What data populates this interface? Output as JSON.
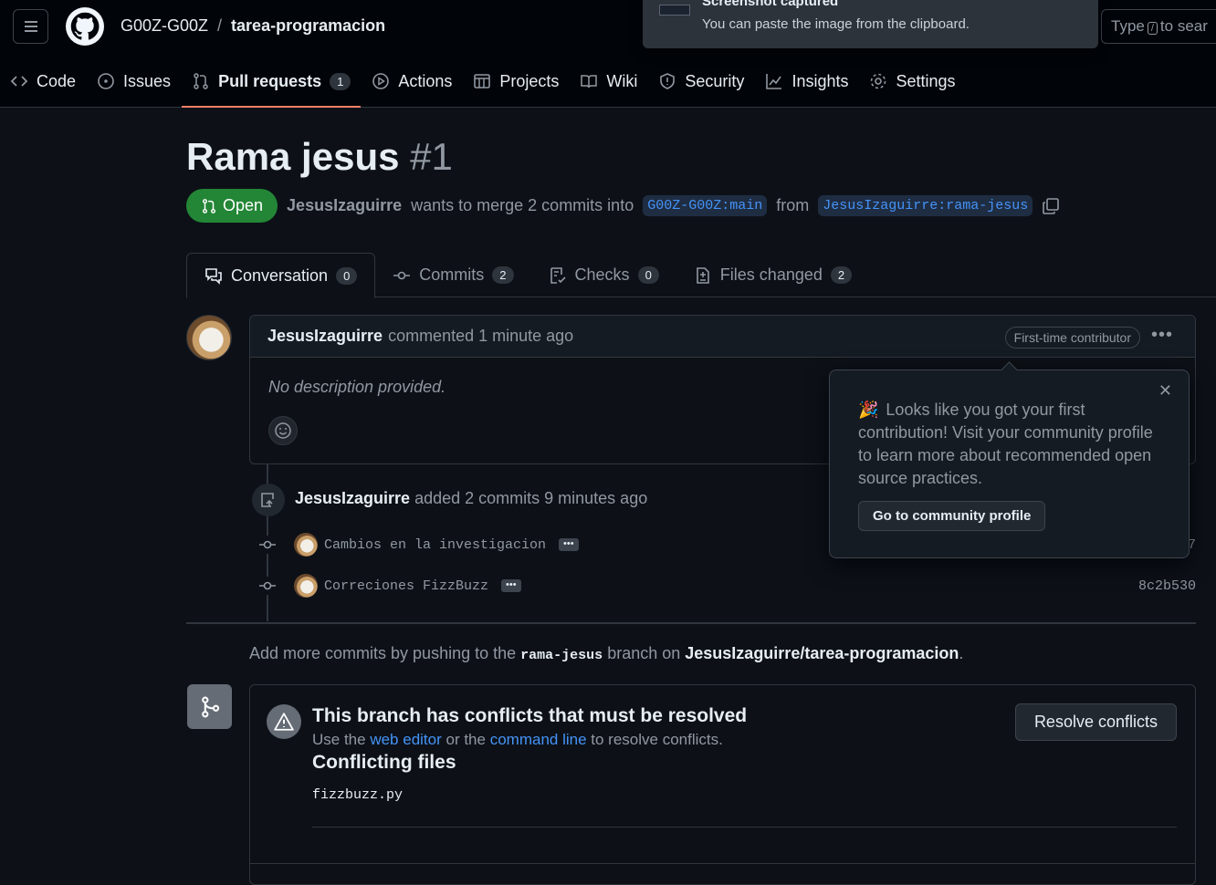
{
  "header": {
    "owner": "G00Z-G00Z",
    "separator": "/",
    "repo": "tarea-programacion",
    "search_prefix": "Type",
    "search_key": "/",
    "search_suffix": "to sear"
  },
  "toast": {
    "title": "Screenshot captured",
    "message": "You can paste the image from the clipboard."
  },
  "nav": {
    "code": "Code",
    "issues": "Issues",
    "pull_requests": "Pull requests",
    "pull_requests_count": "1",
    "actions": "Actions",
    "projects": "Projects",
    "wiki": "Wiki",
    "security": "Security",
    "insights": "Insights",
    "settings": "Settings"
  },
  "pr": {
    "title": "Rama jesus",
    "number": "#1",
    "state": "Open",
    "author": "JesusIzaguirre",
    "merge_text": "wants to merge 2 commits into",
    "base_branch": "G00Z-G00Z:main",
    "from_text": "from",
    "head_branch": "JesusIzaguirre:rama-jesus"
  },
  "tabs": [
    {
      "label": "Conversation",
      "count": "0"
    },
    {
      "label": "Commits",
      "count": "2"
    },
    {
      "label": "Checks",
      "count": "0"
    },
    {
      "label": "Files changed",
      "count": "2"
    }
  ],
  "comment": {
    "author": "JesusIzaguirre",
    "action": "commented 1 minute ago",
    "badge": "First-time contributor",
    "menu": "•••",
    "body": "No description provided."
  },
  "popover": {
    "emoji": "🎉",
    "message": "Looks like you got your first contribution! Visit your community profile to learn more about recommended open source practices.",
    "button": "Go to community profile",
    "close": "✕"
  },
  "push": {
    "author": "JesusIzaguirre",
    "text": "added 2 commits 9 minutes ago"
  },
  "commits": [
    {
      "message": "Cambios en la investigacion",
      "ellipsis": "•••",
      "sha": "7"
    },
    {
      "message": "Correciones FizzBuzz",
      "ellipsis": "•••",
      "sha": "8c2b530"
    }
  ],
  "add_more": {
    "prefix": "Add more commits by pushing to the",
    "branch": "rama-jesus",
    "middle": "branch on",
    "repo": "JesusIzaguirre/tarea-programacion",
    "suffix": "."
  },
  "merge": {
    "heading": "This branch has conflicts that must be resolved",
    "use_the": "Use the",
    "web_editor": "web editor",
    "or_the": "or the",
    "command_line": "command line",
    "to_resolve": "to resolve conflicts.",
    "conflicting_files": "Conflicting files",
    "file": "fizzbuzz.py",
    "resolve_button": "Resolve conflicts"
  },
  "colors": {
    "background": "#0d1117",
    "header": "#010409",
    "open_green": "#238636",
    "link_blue": "#4493f8",
    "active_underline": "#f78166"
  }
}
